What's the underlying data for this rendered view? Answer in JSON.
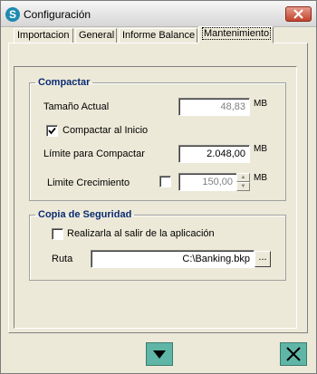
{
  "window": {
    "title": "Configuración",
    "app_icon": "S"
  },
  "tabs": [
    {
      "label": "Importacion"
    },
    {
      "label": "General"
    },
    {
      "label": "Informe Balance"
    },
    {
      "label": "Mantenimiento"
    }
  ],
  "active_tab": "Mantenimiento",
  "compactar": {
    "legend": "Compactar",
    "tamano_actual": {
      "label": "Tamaño Actual",
      "value": "48,83",
      "unit": "MB"
    },
    "compactar_inicio": {
      "label": "Compactar al Inicio",
      "checked": true
    },
    "limite_compactar": {
      "label": "Límite para Compactar",
      "value": "2.048,00",
      "unit": "MB"
    },
    "limite_crecimiento": {
      "label": "Limite Crecimiento",
      "checked": false,
      "value": "150,00",
      "unit": "MB"
    }
  },
  "copia": {
    "legend": "Copia de Seguridad",
    "realizar": {
      "label": "Realizarla al salir de la aplicación",
      "checked": false
    },
    "ruta": {
      "label": "Ruta",
      "value": "C:\\Banking.bkp",
      "browse_label": "..."
    }
  },
  "buttons": {
    "accept_icon": "down-arrow-icon",
    "cancel_icon": "x-icon"
  },
  "colors": {
    "background": "#ece9d8",
    "accent_button": "#5fb6a6",
    "legend_text": "#0a2a6e",
    "close_button": "#c1432c"
  }
}
